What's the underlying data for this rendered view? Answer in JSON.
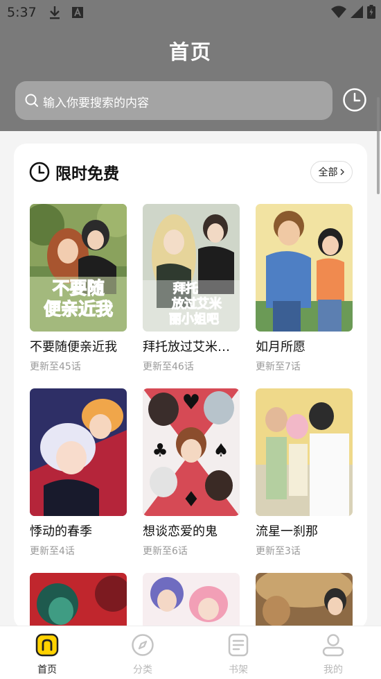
{
  "status": {
    "time": "5:37"
  },
  "header": {
    "title": "首页",
    "search_placeholder": "输入你要搜索的内容"
  },
  "section": {
    "title": "限时免费",
    "all_label": "全部"
  },
  "items": [
    {
      "title": "不要随便亲近我",
      "subtitle": "更新至45话",
      "cover_text": [
        "不要随",
        "便亲近我"
      ]
    },
    {
      "title": "拜托放过艾米丽小姐吧",
      "subtitle": "更新至46话",
      "cover_text": [
        "拜托",
        "放过艾米",
        "丽小姐吧"
      ]
    },
    {
      "title": "如月所愿",
      "subtitle": "更新至7话"
    },
    {
      "title": "悸动的春季",
      "subtitle": "更新至4话"
    },
    {
      "title": "想谈恋爱的鬼",
      "subtitle": "更新至6话"
    },
    {
      "title": "流星一刹那",
      "subtitle": "更新至3话"
    }
  ],
  "nav": [
    {
      "label": "首页",
      "icon": "home-icon",
      "active": true
    },
    {
      "label": "分类",
      "icon": "compass-icon",
      "active": false
    },
    {
      "label": "书架",
      "icon": "bookshelf-icon",
      "active": false
    },
    {
      "label": "我的",
      "icon": "profile-icon",
      "active": false
    }
  ],
  "colors": {
    "header_bg": "#7a7a7a",
    "accent": "#ffd200"
  }
}
